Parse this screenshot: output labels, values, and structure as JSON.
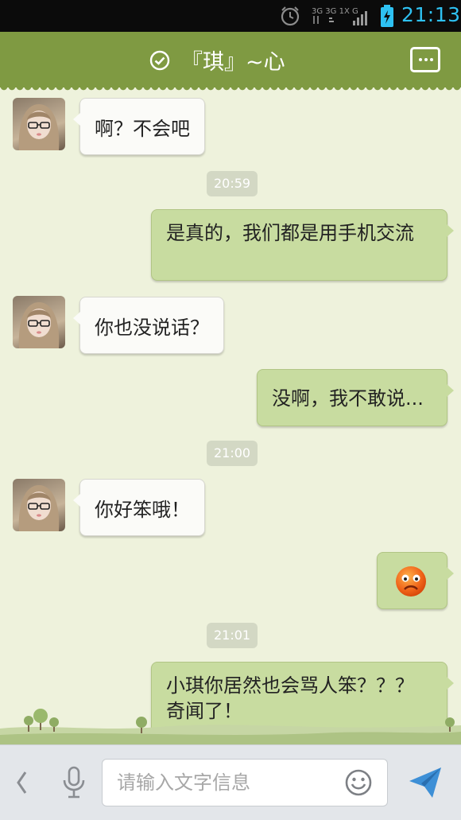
{
  "status_bar": {
    "time": "21:13",
    "alarm_icon": "alarm-icon",
    "network_icon": "signal-icon",
    "battery_icon": "battery-charging-icon"
  },
  "header": {
    "title": "『琪』~心",
    "check_icon": "check-circle-icon",
    "more_icon": "more-icon"
  },
  "messages": [
    {
      "side": "in",
      "text": "啊？不会吧"
    },
    {
      "time": "20:59"
    },
    {
      "side": "out",
      "text": "是真的，我们都是用手机交流"
    },
    {
      "side": "in",
      "text": "你也没说话？"
    },
    {
      "side": "out",
      "text": "没啊，我不敢说..."
    },
    {
      "time": "21:00"
    },
    {
      "side": "in",
      "text": "你好笨哦！"
    },
    {
      "side": "out",
      "emoji": "sad-face-emoji"
    },
    {
      "time": "21:01"
    },
    {
      "side": "out",
      "text": "小琪你居然也会骂人笨？？？奇闻了！"
    }
  ],
  "input_bar": {
    "placeholder": "请输入文字信息",
    "value": ""
  },
  "colors": {
    "header_bg": "#7f9a42",
    "chat_bg": "#eef2dc",
    "outgoing_bubble": "#c8dca0",
    "incoming_bubble": "#fbfbf8",
    "time_pill": "#d3d8c4",
    "status_time": "#2ec1f2"
  }
}
